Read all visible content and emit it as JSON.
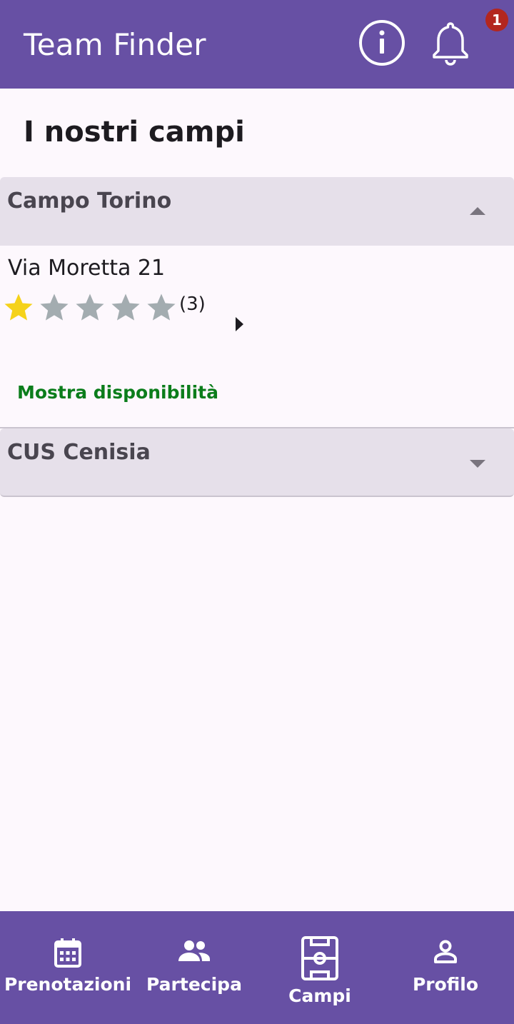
{
  "appbar": {
    "title": "Team Finder",
    "info_icon": "info-circle-icon",
    "bell_icon": "bell-icon",
    "notification_count": "1"
  },
  "page": {
    "title": "I nostri campi"
  },
  "fields": [
    {
      "name": "Campo Torino",
      "expanded": true,
      "address": "Via Moretta 21",
      "rating": 1,
      "max_rating": 5,
      "rating_count": "(3)",
      "availability_label": "Mostra disponibilità"
    },
    {
      "name": "CUS Cenisia",
      "expanded": false
    }
  ],
  "bottom_nav": {
    "items": [
      {
        "label": "Prenotazioni",
        "icon": "calendar-icon"
      },
      {
        "label": "Partecipa",
        "icon": "group-icon"
      },
      {
        "label": "Campi",
        "icon": "soccer-field-icon",
        "active": true
      },
      {
        "label": "Profilo",
        "icon": "person-icon"
      }
    ]
  },
  "colors": {
    "primary": "#6750a4",
    "panel_header": "#e6e0ea",
    "star_filled": "#f5d21a",
    "star_empty": "#a3acb0",
    "link_green": "#0b7d1b",
    "badge": "#b3261e"
  }
}
